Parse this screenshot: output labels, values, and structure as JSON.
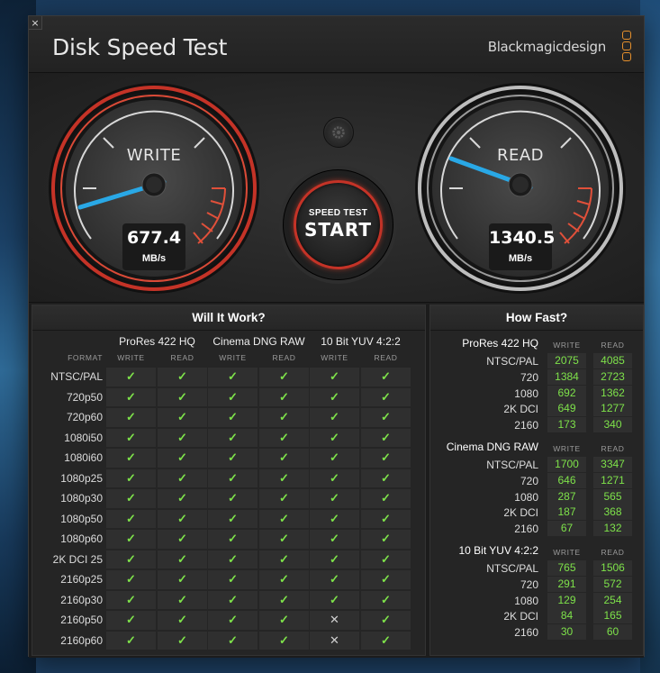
{
  "app": {
    "title": "Disk Speed Test",
    "brand": "Blackmagicdesign",
    "close_glyph": "×"
  },
  "gauges": {
    "write": {
      "label": "WRITE",
      "value": "677.4",
      "unit": "MB/s"
    },
    "read": {
      "label": "READ",
      "value": "1340.5",
      "unit": "MB/s"
    }
  },
  "start_button": {
    "sub": "SPEED TEST",
    "main": "START"
  },
  "settings_icon": "gear-icon",
  "will_it_work": {
    "title": "Will It Work?",
    "format_header": "FORMAT",
    "groups": [
      {
        "name": "ProRes 422 HQ",
        "write": "WRITE",
        "read": "READ"
      },
      {
        "name": "Cinema DNG RAW",
        "write": "WRITE",
        "read": "READ"
      },
      {
        "name": "10 Bit YUV 4:2:2",
        "write": "WRITE",
        "read": "READ"
      }
    ],
    "check": "✓",
    "cross": "✕",
    "rows": [
      {
        "format": "NTSC/PAL",
        "cells": [
          1,
          1,
          1,
          1,
          1,
          1
        ]
      },
      {
        "format": "720p50",
        "cells": [
          1,
          1,
          1,
          1,
          1,
          1
        ]
      },
      {
        "format": "720p60",
        "cells": [
          1,
          1,
          1,
          1,
          1,
          1
        ]
      },
      {
        "format": "1080i50",
        "cells": [
          1,
          1,
          1,
          1,
          1,
          1
        ]
      },
      {
        "format": "1080i60",
        "cells": [
          1,
          1,
          1,
          1,
          1,
          1
        ]
      },
      {
        "format": "1080p25",
        "cells": [
          1,
          1,
          1,
          1,
          1,
          1
        ]
      },
      {
        "format": "1080p30",
        "cells": [
          1,
          1,
          1,
          1,
          1,
          1
        ]
      },
      {
        "format": "1080p50",
        "cells": [
          1,
          1,
          1,
          1,
          1,
          1
        ]
      },
      {
        "format": "1080p60",
        "cells": [
          1,
          1,
          1,
          1,
          1,
          1
        ]
      },
      {
        "format": "2K DCI 25",
        "cells": [
          1,
          1,
          1,
          1,
          1,
          1
        ]
      },
      {
        "format": "2160p25",
        "cells": [
          1,
          1,
          1,
          1,
          1,
          1
        ]
      },
      {
        "format": "2160p30",
        "cells": [
          1,
          1,
          1,
          1,
          1,
          1
        ]
      },
      {
        "format": "2160p50",
        "cells": [
          1,
          1,
          1,
          1,
          0,
          1
        ]
      },
      {
        "format": "2160p60",
        "cells": [
          1,
          1,
          1,
          1,
          0,
          1
        ]
      }
    ]
  },
  "how_fast": {
    "title": "How Fast?",
    "write_header": "WRITE",
    "read_header": "READ",
    "sections": [
      {
        "name": "ProRes 422 HQ",
        "rows": [
          {
            "label": "NTSC/PAL",
            "write": "2075",
            "read": "4085"
          },
          {
            "label": "720",
            "write": "1384",
            "read": "2723"
          },
          {
            "label": "1080",
            "write": "692",
            "read": "1362"
          },
          {
            "label": "2K DCI",
            "write": "649",
            "read": "1277"
          },
          {
            "label": "2160",
            "write": "173",
            "read": "340"
          }
        ]
      },
      {
        "name": "Cinema DNG RAW",
        "rows": [
          {
            "label": "NTSC/PAL",
            "write": "1700",
            "read": "3347"
          },
          {
            "label": "720",
            "write": "646",
            "read": "1271"
          },
          {
            "label": "1080",
            "write": "287",
            "read": "565"
          },
          {
            "label": "2K DCI",
            "write": "187",
            "read": "368"
          },
          {
            "label": "2160",
            "write": "67",
            "read": "132"
          }
        ]
      },
      {
        "name": "10 Bit YUV 4:2:2",
        "rows": [
          {
            "label": "NTSC/PAL",
            "write": "765",
            "read": "1506"
          },
          {
            "label": "720",
            "write": "291",
            "read": "572"
          },
          {
            "label": "1080",
            "write": "129",
            "read": "254"
          },
          {
            "label": "2K DCI",
            "write": "84",
            "read": "165"
          },
          {
            "label": "2160",
            "write": "30",
            "read": "60"
          }
        ]
      }
    ]
  },
  "colors": {
    "accent_red": "#c43327",
    "needle_blue": "#29a8e6",
    "check_green": "#7ee24a",
    "brand_orange": "#e6902c"
  }
}
